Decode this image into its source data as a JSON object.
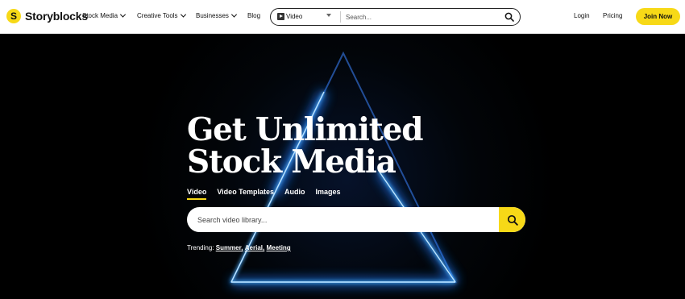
{
  "header": {
    "logo_mark": "S",
    "logo_text": "Storyblocks",
    "nav": [
      {
        "label": "Stock Media"
      },
      {
        "label": "Creative Tools"
      },
      {
        "label": "Businesses"
      },
      {
        "label": "Blog"
      }
    ],
    "search": {
      "selected_type": "Video",
      "placeholder": "Search..."
    },
    "login_label": "Login",
    "pricing_label": "Pricing",
    "join_label": "Join Now"
  },
  "hero": {
    "headline_line1": "Get Unlimited",
    "headline_line2": "Stock Media",
    "tabs": [
      {
        "label": "Video",
        "active": true
      },
      {
        "label": "Video Templates",
        "active": false
      },
      {
        "label": "Audio",
        "active": false
      },
      {
        "label": "Images",
        "active": false
      }
    ],
    "search_placeholder": "Search video library...",
    "trending_label": "Trending:",
    "trending": [
      "Summer,",
      "Aerial,",
      "Meeting"
    ]
  },
  "colors": {
    "accent": "#f7d917",
    "neon": "#3aa0ff"
  }
}
